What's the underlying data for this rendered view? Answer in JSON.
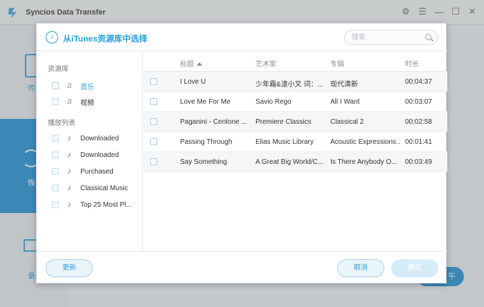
{
  "app": {
    "title": "Syncios Data Transfer",
    "side_labels": [
      "传",
      "恢",
      "备"
    ],
    "action_button": "午"
  },
  "dialog": {
    "title": "从iTunes资源库中选择",
    "search_placeholder": "搜索",
    "left": {
      "library_section": "资源库",
      "library_items": [
        {
          "label": "音乐",
          "active": true
        },
        {
          "label": "视频",
          "active": false
        }
      ],
      "playlist_section": "播放列表",
      "playlist_items": [
        {
          "label": "Downloaded"
        },
        {
          "label": "Downloaded"
        },
        {
          "label": "Purchased"
        },
        {
          "label": "Classical Music"
        },
        {
          "label": "Top 25 Most Pl..."
        }
      ]
    },
    "table": {
      "headers": {
        "title": "标题",
        "artist": "艺术家",
        "album": "专辑",
        "duration": "时长"
      },
      "rows": [
        {
          "title": "I Love U",
          "artist": "少年霜&渣小叉 词：...",
          "album": "现代清新",
          "duration": "00:04:37"
        },
        {
          "title": "Love Me For Me",
          "artist": "Savio Rego",
          "album": "All I Want",
          "duration": "00:03:07"
        },
        {
          "title": "Paganini - Centone ...",
          "artist": "Premiere Classics",
          "album": "Classical 2",
          "duration": "00:02:58"
        },
        {
          "title": "Passing Through",
          "artist": "Elias Music Library",
          "album": "Acoustic Expressions...",
          "duration": "00:01:41"
        },
        {
          "title": "Say Something",
          "artist": "A Great Big World/C...",
          "album": "Is There Anybody O...",
          "duration": "00:03:49"
        }
      ]
    },
    "footer": {
      "refresh": "更新",
      "cancel": "取消",
      "confirm": "确定"
    }
  },
  "colors": {
    "accent": "#2a9fd8",
    "sidebar_active": "#1b8ed3"
  }
}
